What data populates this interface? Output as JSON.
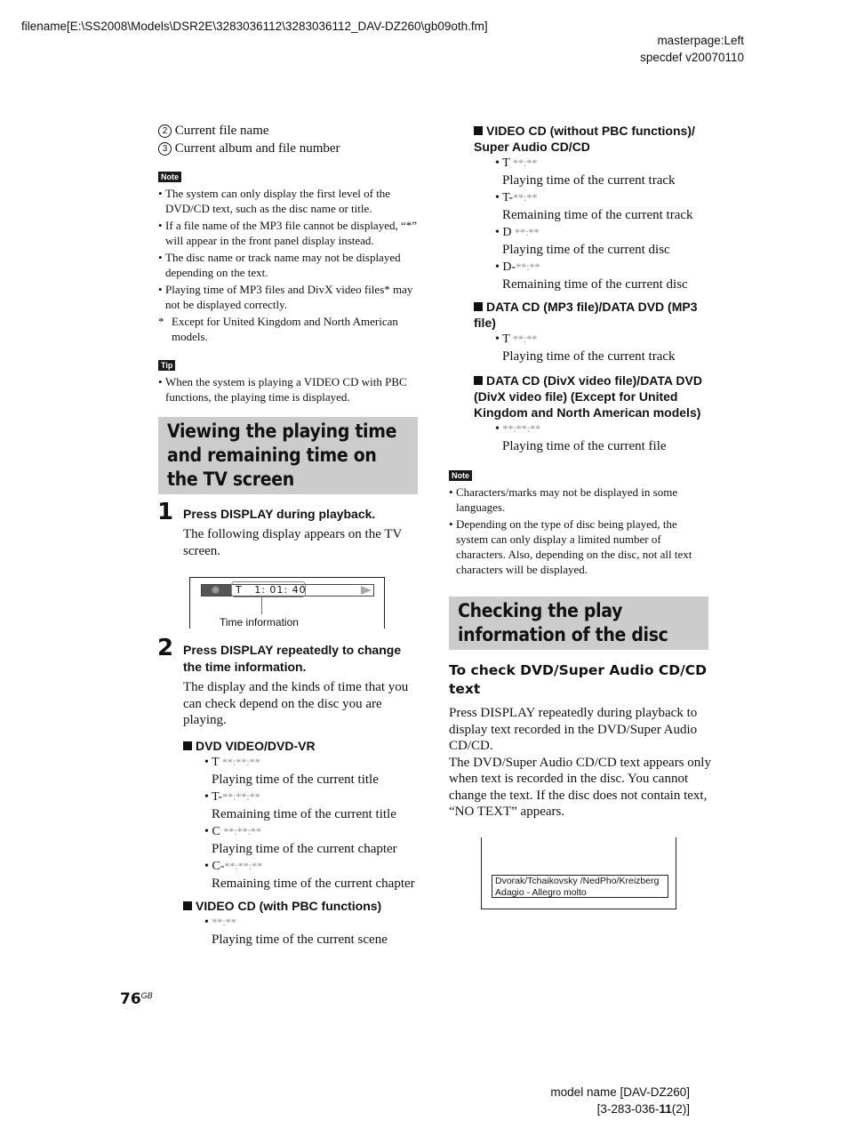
{
  "header": {
    "filename": "filename[E:\\SS2008\\Models\\DSR2E\\3283036112\\3283036112_DAV-DZ260\\gb09oth.fm]",
    "masterpage": "masterpage:Left",
    "specdef": "specdef v20070110"
  },
  "left": {
    "items": [
      {
        "num": "2",
        "text": "Current file name"
      },
      {
        "num": "3",
        "text": "Current album and file number"
      }
    ],
    "note_label": "Note",
    "notes": [
      "The system can only display the first level of the DVD/CD text, such as the disc name or title.",
      "If a file name of the MP3 file cannot be displayed, “*” will appear in the front panel display instead.",
      "The disc name or track name may not be displayed depending on the text.",
      "Playing time of MP3 files and DivX video files* may not be displayed correctly."
    ],
    "footnote_mark": "*",
    "footnote": "Except for United Kingdom and North American models.",
    "tip_label": "Tip",
    "tips": [
      "When the system is playing a VIDEO CD with PBC functions, the playing time is displayed."
    ],
    "section_title": "Viewing the playing time and remaining time on the TV screen",
    "step1": {
      "num": "1",
      "title": "Press DISPLAY during playback.",
      "body": "The following display appears on the TV screen."
    },
    "display_fig": {
      "time_prefix": "T",
      "time_value": "1: 01: 40",
      "callout": "Time information",
      "icon": "clock-icon",
      "play_icon": "play-icon"
    },
    "step2": {
      "num": "2",
      "title": "Press DISPLAY repeatedly to change the time information.",
      "body": "The display and the kinds of time that you can check depend on the disc you are playing."
    },
    "groups": [
      {
        "title": "DVD VIDEO/DVD-VR",
        "items": [
          {
            "prefix": "T ",
            "code": "**:**:**",
            "desc": "Playing time of the current title"
          },
          {
            "prefix": "T-",
            "code": "**:**:**",
            "desc": "Remaining time of the current title"
          },
          {
            "prefix": "C ",
            "code": "**:**:**",
            "desc": "Playing time of the current chapter"
          },
          {
            "prefix": "C-",
            "code": "**:**:**",
            "desc": "Remaining time of the current chapter"
          }
        ]
      },
      {
        "title": "VIDEO CD (with PBC functions)",
        "items": [
          {
            "prefix": "",
            "code": "**:**",
            "desc": "Playing time of the current scene"
          }
        ]
      }
    ]
  },
  "right": {
    "groups": [
      {
        "title": "VIDEO CD (without PBC functions)/ Super Audio CD/CD",
        "items": [
          {
            "prefix": "T ",
            "code": "**:**",
            "desc": "Playing time of the current track"
          },
          {
            "prefix": "T-",
            "code": "**:**",
            "desc": "Remaining time of the current track"
          },
          {
            "prefix": "D ",
            "code": "**:**",
            "desc": "Playing time of the current disc"
          },
          {
            "prefix": "D-",
            "code": "**:**",
            "desc": "Remaining time of the current disc"
          }
        ]
      },
      {
        "title": "DATA CD (MP3 file)/DATA DVD (MP3 file)",
        "items": [
          {
            "prefix": "T ",
            "code": "**:**",
            "desc": "Playing time of the current track"
          }
        ]
      },
      {
        "title": "DATA CD (DivX video file)/DATA DVD (DivX video file) (Except for United Kingdom and North American models)",
        "items": [
          {
            "prefix": "",
            "code": "**:**:**",
            "desc": "Playing time of the current file"
          }
        ]
      }
    ],
    "note_label": "Note",
    "notes": [
      "Characters/marks may not be displayed in some languages.",
      "Depending on the type of disc being played, the system can only display a limited number of characters. Also, depending on the disc, not all text characters will be displayed."
    ],
    "section_title": "Checking the play information of the disc",
    "subheading": "To check DVD/Super Audio CD/CD text",
    "para1": "Press DISPLAY repeatedly during playback to display text recorded in the DVD/Super Audio CD/CD.",
    "para2": "The DVD/Super Audio CD/CD text appears only when text is recorded in the disc. You cannot change the text. If the disc does not contain text, “NO TEXT” appears.",
    "text_fig": {
      "line1": "Dvorak/Tchaikovsky /NedPho/Kreizberg",
      "line2": "Adagio - Allegro molto"
    }
  },
  "footer": {
    "page_number": "76",
    "page_suffix": "GB",
    "model_name": "model name [DAV-DZ260]",
    "code_pre": "[3-283-036-",
    "code_bold": "11",
    "code_post": "(2)]"
  }
}
